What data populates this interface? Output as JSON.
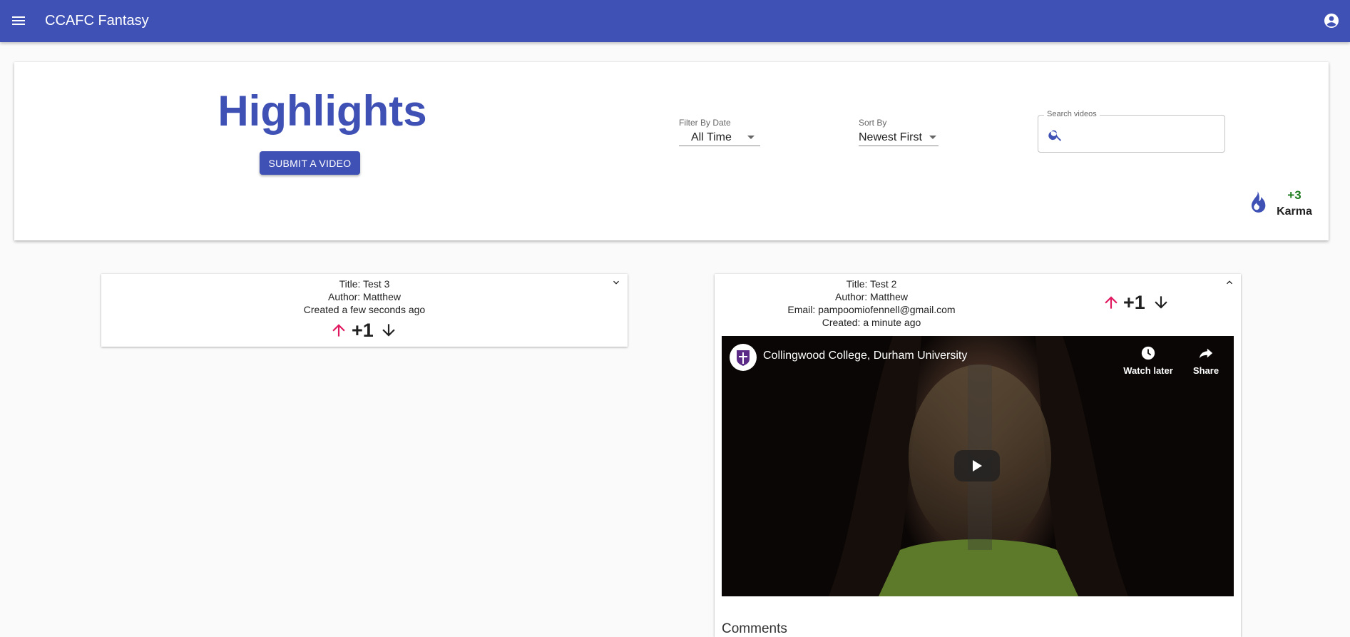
{
  "appbar": {
    "title": "CCAFC Fantasy",
    "menu_icon": "menu-icon",
    "account_icon": "account-circle-icon",
    "color": "#3f51b5"
  },
  "header": {
    "title": "Highlights",
    "submit_label": "SUBMIT A VIDEO",
    "filter": {
      "label": "Filter By Date",
      "value": "All Time"
    },
    "sort": {
      "label": "Sort By",
      "value": "Newest First"
    },
    "search": {
      "label": "Search videos",
      "value": "",
      "icon": "search-icon"
    },
    "karma": {
      "value": "+3",
      "label": "Karma",
      "icon": "flame-icon"
    }
  },
  "videos": [
    {
      "title": "Title: Test 3",
      "author": "Author: Matthew",
      "created": "Created a few seconds ago",
      "score": "+1",
      "expanded": false
    },
    {
      "title": "Title: Test 2",
      "author": "Author: Matthew",
      "email": "Email: pampoomiofennell@gmail.com",
      "created": "Created: a minute ago",
      "score": "+1",
      "expanded": true,
      "player": {
        "channel": "Collingwood College, Durham University",
        "watch_later": "Watch later",
        "share": "Share"
      },
      "comments_heading": "Comments"
    }
  ],
  "colors": {
    "upvote": "#e0185f",
    "downvote": "#212121",
    "karma": "#1b7a1b"
  }
}
